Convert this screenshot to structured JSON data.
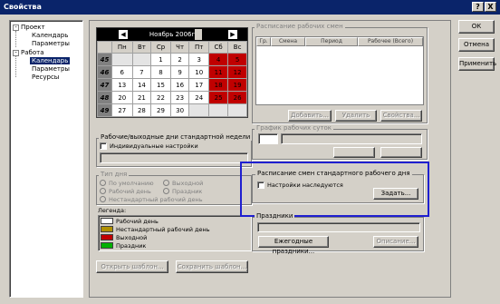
{
  "window": {
    "title": "Свойства",
    "controls": [
      "?",
      "X"
    ]
  },
  "tree": {
    "items": [
      {
        "label": "Проект",
        "expander": "-"
      },
      {
        "label": "Календарь"
      },
      {
        "label": "Параметры"
      },
      {
        "label": "Работа",
        "expander": "-"
      },
      {
        "label": "Календарь"
      },
      {
        "label": "Параметры"
      },
      {
        "label": "Ресурсы"
      }
    ]
  },
  "calendar": {
    "month_label": "Ноябрь  2006г",
    "prev": "◀",
    "next": "▶",
    "weekdays": [
      "Пн",
      "Вт",
      "Ср",
      "Чт",
      "Пт",
      "Сб",
      "Вс"
    ],
    "weeks": [
      {
        "num": "45",
        "days": [
          "",
          "",
          "1",
          "2",
          "3",
          "4",
          "5"
        ]
      },
      {
        "num": "46",
        "days": [
          "6",
          "7",
          "8",
          "9",
          "10",
          "11",
          "12"
        ]
      },
      {
        "num": "47",
        "days": [
          "13",
          "14",
          "15",
          "16",
          "17",
          "18",
          "19"
        ]
      },
      {
        "num": "48",
        "days": [
          "20",
          "21",
          "22",
          "23",
          "24",
          "25",
          "26"
        ]
      },
      {
        "num": "49",
        "days": [
          "27",
          "28",
          "29",
          "30",
          "",
          "",
          ""
        ]
      }
    ]
  },
  "workweek": {
    "group_label": "Рабочие/выходные дни стандартной недели",
    "individual_label": "Индивидуальные настройки"
  },
  "days": {
    "group_label": "Тип дня",
    "options": [
      "По умолчанию",
      "Выходной",
      "Рабочий день",
      "Праздник",
      "Нестандартный рабочий день"
    ]
  },
  "legend": {
    "label": "Легенда:",
    "items": [
      {
        "label": "Рабочий день",
        "color": "#ffffff"
      },
      {
        "label": "Нестандартный рабочий день",
        "color": "#b09000"
      },
      {
        "label": "Выходной",
        "color": "#c00000"
      },
      {
        "label": "Праздник",
        "color": "#00b000"
      }
    ]
  },
  "template_buttons": {
    "open": "Открыть шаблон...",
    "save": "Сохранить шаблон..."
  },
  "schedule": {
    "group_label": "Расписание рабочих смен",
    "columns": [
      "Гр.",
      "Смена",
      "Период",
      "Рабочее (Всего)"
    ],
    "add": "Добавить...",
    "delete": "Удалить",
    "props": "Свойства..."
  },
  "time_graph": {
    "group_label": "График рабочих суток"
  },
  "standard_shift": {
    "group_label": "Расписание смен стандартного рабочего дня",
    "inherit_label": "Настройки наследуются",
    "set_button": "Задать..."
  },
  "holidays": {
    "group_label": "Праздники",
    "yearly": "Ежегодные праздники...",
    "list": "Описание..."
  },
  "dialog_buttons": {
    "ok": "ОК",
    "cancel": "Отмена",
    "apply": "Применить"
  }
}
